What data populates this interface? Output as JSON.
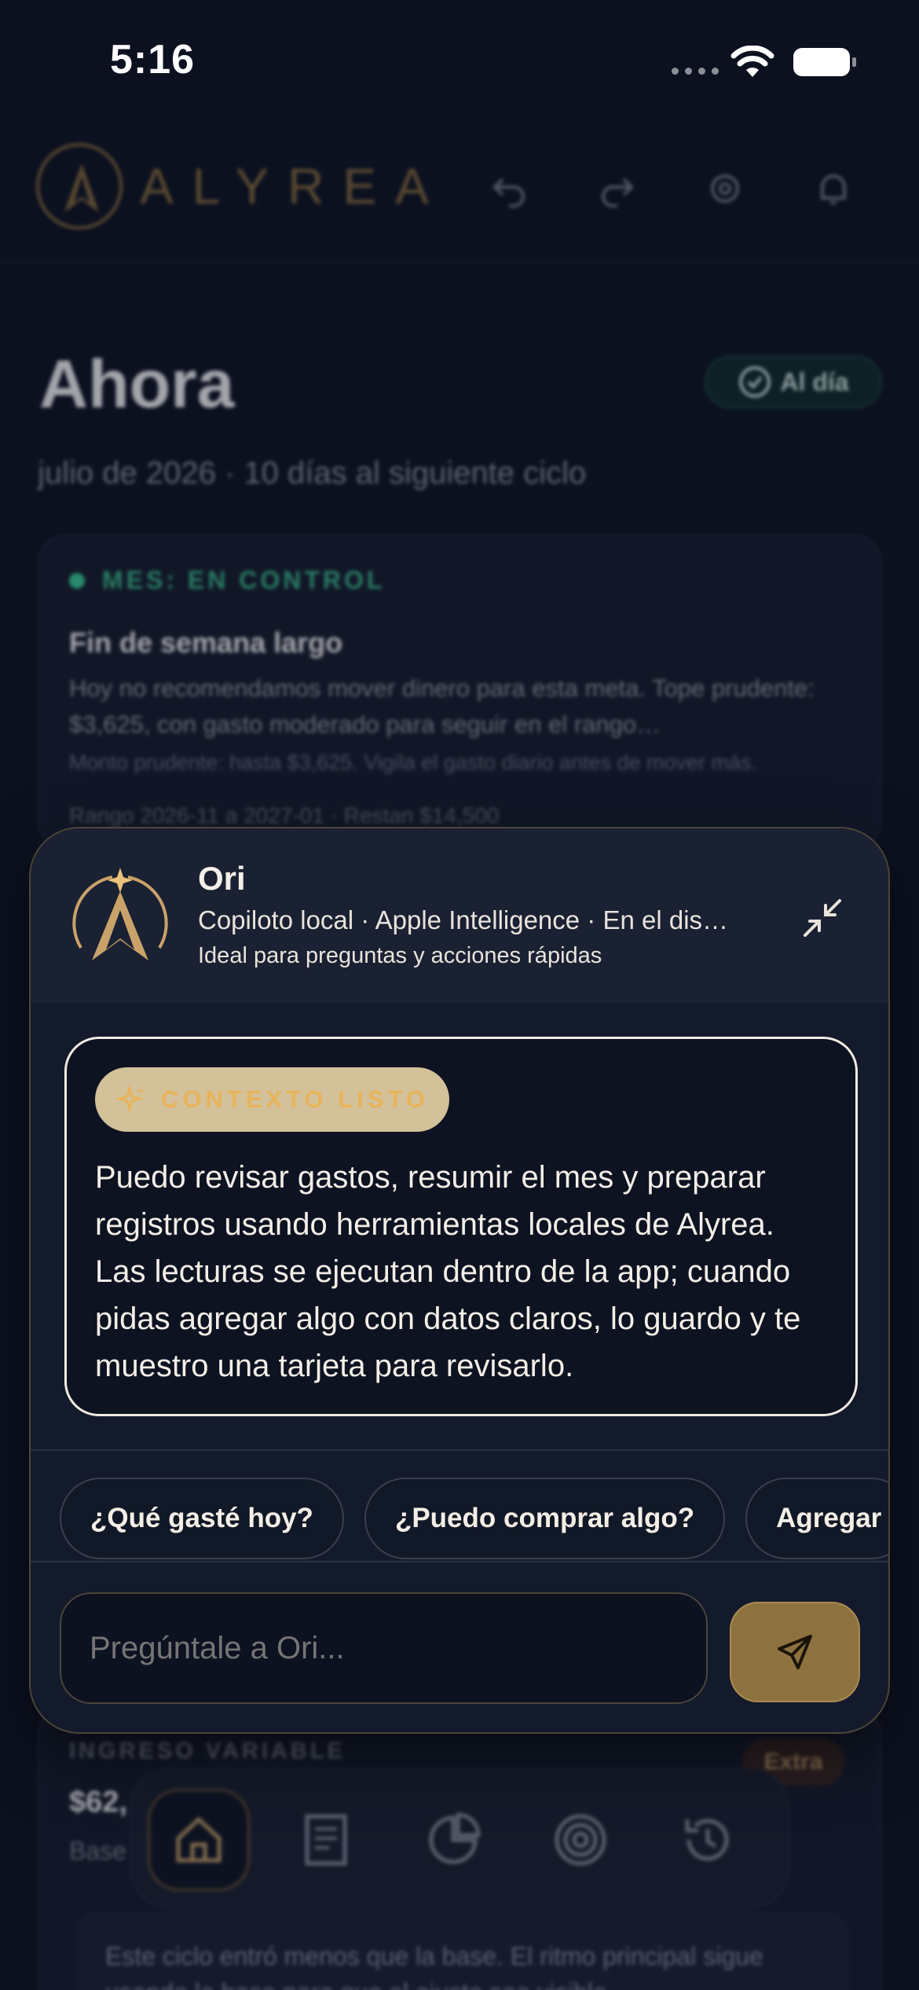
{
  "status_bar": {
    "time": "5:16"
  },
  "header": {
    "brand": "ALYREA"
  },
  "page": {
    "title": "Ahora",
    "badge": "Al día",
    "subtitle": "julio de 2026 · 10 días al siguiente ciclo"
  },
  "card_month": {
    "status": "MES: EN CONTROL",
    "goal_title": "Fin de semana largo",
    "description": "Hoy no recomendamos mover dinero para esta meta. Tope prudente: $3,625, con gasto moderado para seguir en el rango…",
    "detail": "Monto prudente: hasta $3,625. Vigila el gasto diario antes de mover más.",
    "range": "Rango 2026-11 a 2027-01 · Restan $14,500"
  },
  "card_income": {
    "label": "INGRESO VARIABLE",
    "value": "$62,",
    "base": "Base",
    "extra_badge": "Extra",
    "note": "Este ciclo entró menos que la base. El ritmo principal sigue usando la base para que el ajuste sea visible."
  },
  "ori": {
    "name": "Ori",
    "subtitle": "Copiloto local · Apple Intelligence · En el dispositivo",
    "subtitle2": "Ideal para preguntas y acciones rápidas",
    "chip": "CONTEXTO LISTO",
    "message": "Puedo revisar gastos, resumir el mes y preparar registros usando herramientas locales de Alyrea. Las lecturas se ejecutan dentro de la app; cuando pidas agregar algo con datos claros, lo guardo y te muestro una tarjeta para revisarlo.",
    "suggestions": [
      "¿Qué gasté hoy?",
      "¿Puedo comprar algo?",
      "Agregar"
    ],
    "input_placeholder": "Pregúntale a Ori..."
  },
  "tabbar": {
    "tabs": [
      "home-icon",
      "receipt-icon",
      "pie-chart-icon",
      "target-icon",
      "history-icon"
    ],
    "active": "home-icon"
  },
  "colors": {
    "background": "#0c1120",
    "gold": "#c9a26a",
    "accent_green": "#3bd79b",
    "panel": "#131a2b"
  }
}
